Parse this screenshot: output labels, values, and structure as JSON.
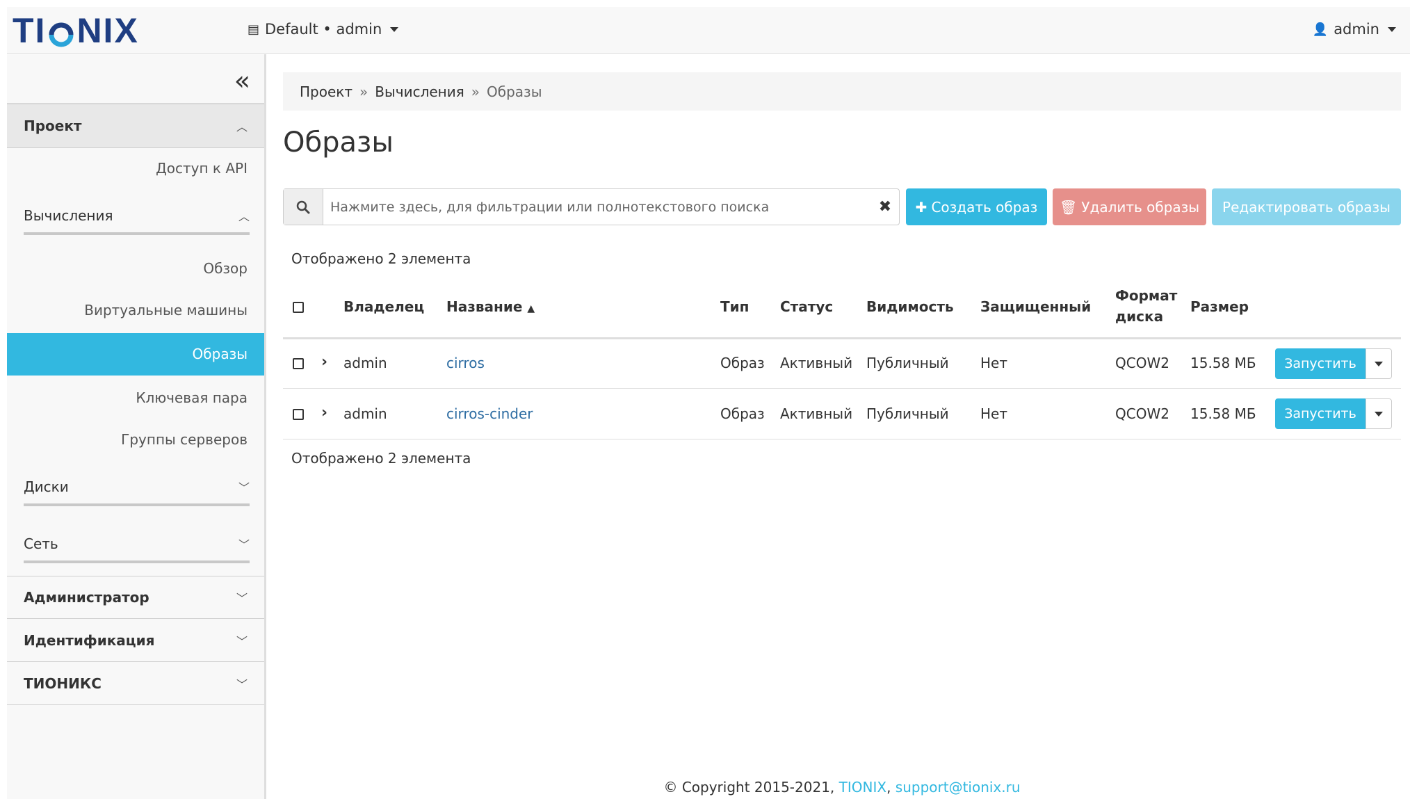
{
  "header": {
    "brand": "TIONIX",
    "project_switcher": "Default • admin",
    "user": "admin"
  },
  "sidebar": {
    "project": "Проект",
    "api_access": "Доступ к API",
    "compute": "Вычисления",
    "compute_items": [
      "Обзор",
      "Виртуальные машины",
      "Образы",
      "Ключевая пара",
      "Группы серверов"
    ],
    "volumes": "Диски",
    "network": "Сеть",
    "admin": "Администратор",
    "identity": "Идентификация",
    "tionix": "ТИОНИКС"
  },
  "breadcrumb": {
    "items": [
      "Проект",
      "Вычисления",
      "Образы"
    ],
    "separator": "»"
  },
  "page": {
    "title": "Образы",
    "search_placeholder": "Нажмите здесь, для фильтрации или полнотекстового поиска",
    "create_label": "Создать образ",
    "delete_label": "Удалить образы",
    "edit_label": "Редактировать образы",
    "count_text": "Отображено 2 элемента"
  },
  "table": {
    "headers": {
      "owner": "Владелец",
      "name": "Название",
      "type": "Тип",
      "status": "Статус",
      "visibility": "Видимость",
      "protected": "Защищенный",
      "format_line1": "Формат",
      "format_line2": "диска",
      "size": "Размер"
    },
    "rows": [
      {
        "owner": "admin",
        "name": "cirros",
        "type": "Образ",
        "status": "Активный",
        "visibility": "Публичный",
        "protected": "Нет",
        "format": "QCOW2",
        "size": "15.58 МБ",
        "action": "Запустить"
      },
      {
        "owner": "admin",
        "name": "cirros-cinder",
        "type": "Образ",
        "status": "Активный",
        "visibility": "Публичный",
        "protected": "Нет",
        "format": "QCOW2",
        "size": "15.58 МБ",
        "action": "Запустить"
      }
    ]
  },
  "footer": {
    "copyright": "© Copyright 2015-2021,",
    "company": "TIONIX",
    "email": "support@tionix.ru"
  },
  "colors": {
    "primary": "#32b8e0",
    "danger": "#e6908b",
    "link": "#2d6ca2",
    "brand": "#1f3e82"
  }
}
